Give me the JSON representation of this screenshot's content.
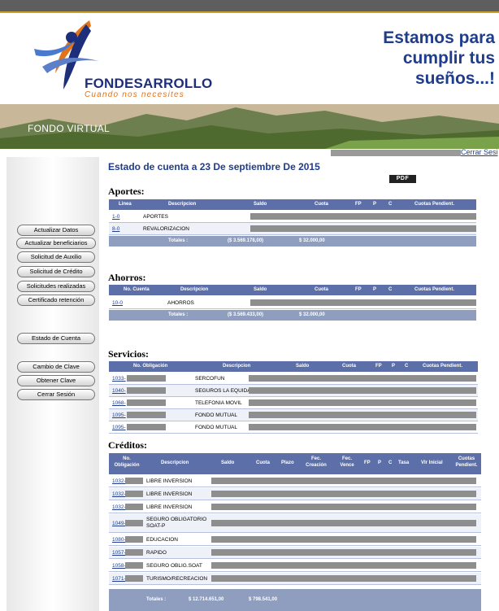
{
  "header": {
    "brand": "FONDESARROLLO",
    "tagline": "Cuando nos necesites",
    "slogan_lines": [
      "Estamos para",
      "cumplir tus",
      "sueños...!"
    ],
    "banner_label": "FONDO VIRTUAL",
    "logout_link": "Cerrar Sesi"
  },
  "sidebar": {
    "items": [
      "Actualizar Datos",
      "Actualizar beneficiarios",
      "Solicitud de Auxilio",
      "Solicitud de Crédito",
      "Solicitudes realizadas",
      "Certificado retención",
      "Estado de Cuenta",
      "Cambio de Clave",
      "Obtener Clave",
      "Cerrar Sesión"
    ]
  },
  "main": {
    "title": "Estado de cuenta a 23 De septiembre De 2015",
    "pdf_label": "PDF"
  },
  "aportes": {
    "title": "Aportes:",
    "headers": [
      "Linea",
      "Descripcion",
      "Saldo",
      "Cuota",
      "FP",
      "P",
      "C",
      "Cuotas Pendient."
    ],
    "rows": [
      {
        "linea": "1-0",
        "descripcion": "APORTES"
      },
      {
        "linea": "8-0",
        "descripcion": "REVALORIZACION"
      }
    ],
    "totales_label": "Totales :",
    "total_saldo": "($ 3.569.178,00)",
    "total_cuota": "$ 32.000,00"
  },
  "ahorros": {
    "title": "Ahorros:",
    "headers": [
      "No. Cuenta",
      "Descripcion",
      "Saldo",
      "Cuota",
      "FP",
      "P",
      "C",
      "Cuotas Pendient."
    ],
    "rows": [
      {
        "cuenta": "10-0",
        "descripcion": "AHORROS"
      }
    ],
    "totales_label": "Totales :",
    "total_saldo": "($ 3.569.433,00)",
    "total_cuota": "$ 32.000,00"
  },
  "servicios": {
    "title": "Servicios:",
    "headers": [
      "No. Obligación",
      "Descripcion",
      "Saldo",
      "Cuota",
      "FP",
      "P",
      "C",
      "Cuotas Pendient."
    ],
    "rows": [
      {
        "id": "1033-",
        "descripcion": "SERCOFUN"
      },
      {
        "id": "1040-",
        "descripcion": "SEGUROS LA EQUIDA"
      },
      {
        "id": "1068-",
        "descripcion": "TELEFONIA MOVIL"
      },
      {
        "id": "1095-",
        "descripcion": "FONDO MUTUAL"
      },
      {
        "id": "1095-",
        "descripcion": "FONDO MUTUAL"
      }
    ]
  },
  "creditos": {
    "title": "Créditos:",
    "headers": [
      "No. Obligación",
      "Descripcion",
      "Saldo",
      "Cuota",
      "Plazo",
      "Fec. Creación",
      "Fec. Vence",
      "FP",
      "P",
      "C",
      "Tasa",
      "Vlr Inicial",
      "Cuotas Pendient."
    ],
    "rows": [
      {
        "id": "1032-",
        "descripcion": "LIBRE INVERSION"
      },
      {
        "id": "1032-",
        "descripcion": "LIBRE INVERSION"
      },
      {
        "id": "1032-",
        "descripcion": "LIBRE INVERSION"
      },
      {
        "id": "1049-",
        "descripcion": "SEGURO OBLIGATORIO SOAT-P"
      },
      {
        "id": "1080-",
        "descripcion": "EDUCACION"
      },
      {
        "id": "1057-",
        "descripcion": "RAPIDO"
      },
      {
        "id": "1058-",
        "descripcion": "SEGURO OBLIG.SOAT"
      },
      {
        "id": "1071-",
        "descripcion": "TURISMO/RECREACION"
      }
    ],
    "totales_label": "Totales :",
    "total_saldo": "$ 12.714.651,00",
    "total_cuota": "$ 798.541,00"
  },
  "colors": {
    "header_blue": "#5c6fa8",
    "title_blue": "#1f3d8c",
    "brand_orange": "#e2731a"
  }
}
